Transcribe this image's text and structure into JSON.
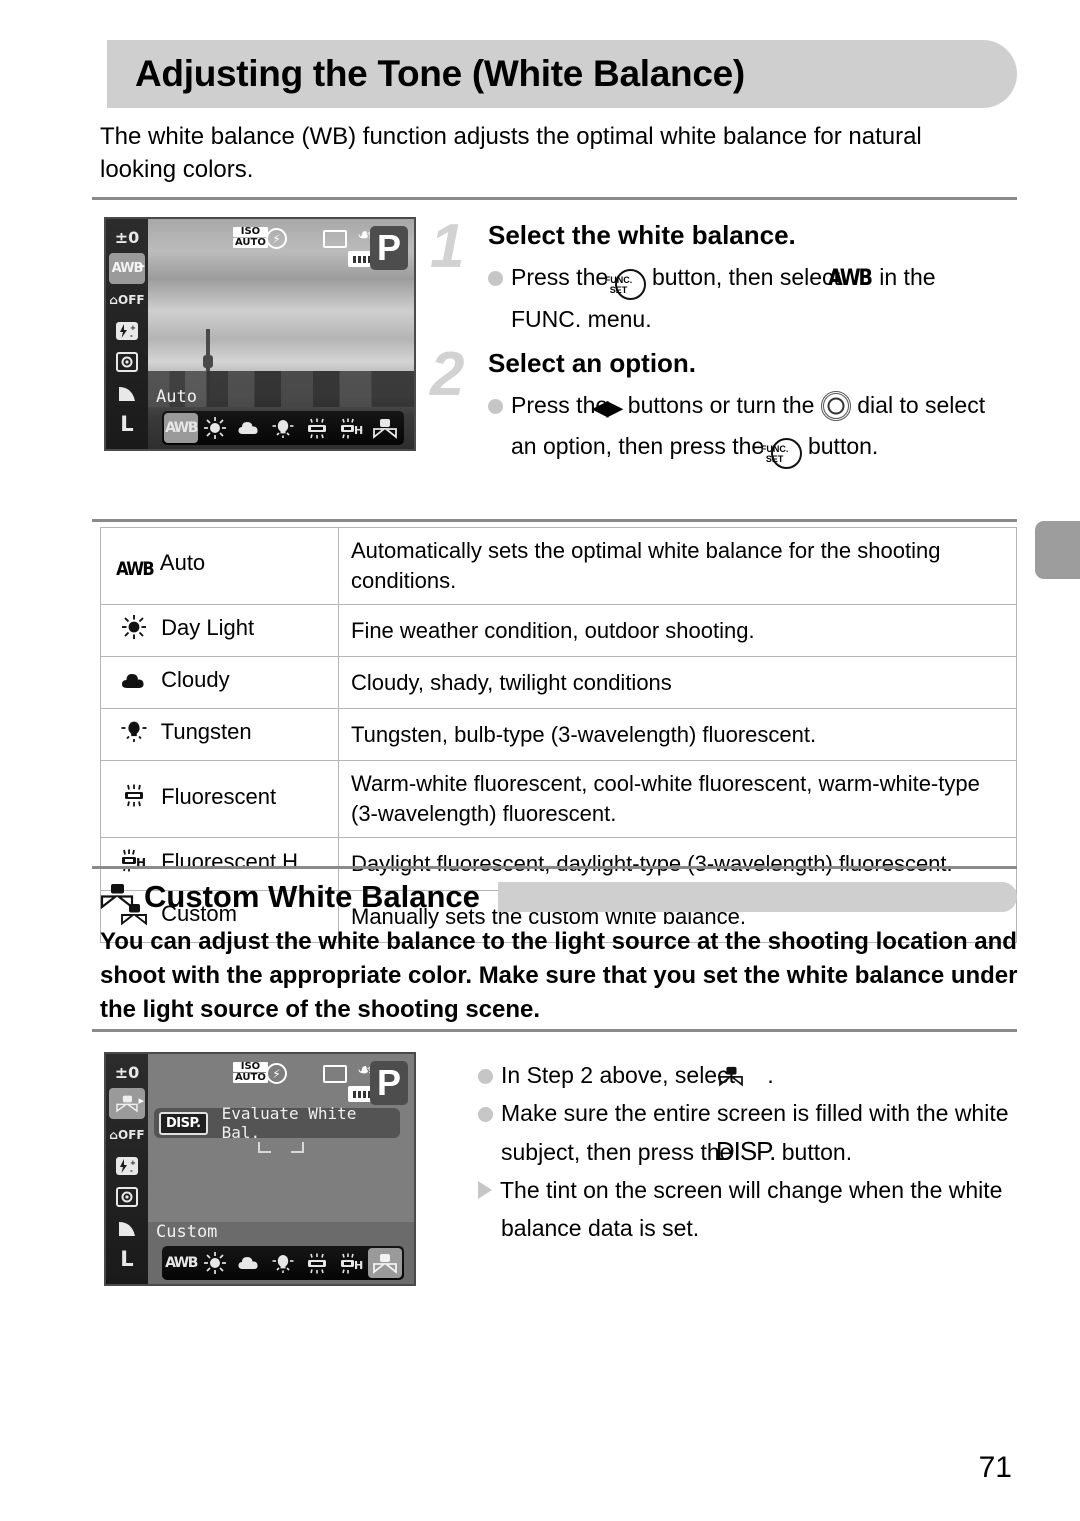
{
  "title": "Adjusting the Tone (White Balance)",
  "intro": "The white balance (WB) function adjusts the optimal white balance for natural looking colors.",
  "steps": [
    {
      "number": "1",
      "heading": "Select the white balance.",
      "body_before": "Press the",
      "body_mid": "button, then select",
      "body_after": "in the FUNC. menu.",
      "icon_funcset": "FUNC.SET",
      "icon_awb": "AWB"
    },
    {
      "number": "2",
      "heading": "Select an option.",
      "body_before": "Press the",
      "body_mid": "buttons or turn the",
      "body_mid2": "dial to select an option, then press the",
      "body_after": "button.",
      "icon_lr": "left-right-buttons",
      "icon_dial": "control-dial",
      "icon_funcset": "FUNC.SET"
    }
  ],
  "table": {
    "rows": [
      {
        "icon": "awb-icon",
        "name": "Auto",
        "desc": "Automatically sets the optimal white balance for the shooting conditions."
      },
      {
        "icon": "daylight-icon",
        "name": "Day Light",
        "desc": "Fine weather condition, outdoor shooting."
      },
      {
        "icon": "cloudy-icon",
        "name": "Cloudy",
        "desc": "Cloudy, shady, twilight conditions"
      },
      {
        "icon": "tungsten-icon",
        "name": "Tungsten",
        "desc": "Tungsten, bulb-type (3-wavelength) fluorescent."
      },
      {
        "icon": "fluorescent-icon",
        "name": "Fluorescent",
        "desc": "Warm-white fluorescent, cool-white fluorescent, warm-white-type (3-wavelength) fluorescent."
      },
      {
        "icon": "fluorescent-h-icon",
        "name": "Fluorescent H",
        "desc": "Daylight fluorescent, daylight-type (3-wavelength) fluorescent."
      },
      {
        "icon": "custom-wb-icon",
        "name": "Custom",
        "desc": "Manually sets the custom white balance."
      }
    ]
  },
  "custom_section": {
    "heading": "Custom White Balance",
    "paragraph": "You can adjust the white balance to the light source at the shooting location and shoot with the appropriate color. Make sure that you set the white balance under the light source of the shooting scene.",
    "items": [
      {
        "bullet": "dot",
        "text_before": "In Step 2 above, select",
        "text_after": "."
      },
      {
        "bullet": "dot",
        "text_before": "Make sure the entire screen is filled with the white subject, then press the",
        "text_after": "button.",
        "icon": "DISP."
      },
      {
        "bullet": "triangle",
        "text_before": "The tint on the screen will change when the white balance data is set.",
        "text_after": ""
      }
    ]
  },
  "lcd_screen_1": {
    "sidebar": [
      "±0",
      "AWB",
      "OFF",
      "FEC",
      "MET",
      "QUAL",
      "L"
    ],
    "sidebar_selected": "AWB",
    "status": {
      "iso_line1": "ISO",
      "iso_line2": "AUTO",
      "mode": "P"
    },
    "mode_label": "Auto",
    "options": [
      "AWB",
      "Day Light",
      "Cloudy",
      "Tungsten",
      "Fluorescent",
      "Fluorescent H",
      "Custom"
    ],
    "selected_option": "AWB"
  },
  "lcd_screen_2": {
    "sidebar": [
      "±0",
      "CWB",
      "OFF",
      "FEC",
      "MET",
      "QUAL",
      "L"
    ],
    "sidebar_selected": "CWB",
    "status": {
      "iso_line1": "ISO",
      "iso_line2": "AUTO",
      "mode": "P"
    },
    "disp_chip": "DISP.",
    "disp_text": "Evaluate White Bal.",
    "mode_label": "Custom",
    "options": [
      "AWB",
      "Day Light",
      "Cloudy",
      "Tungsten",
      "Fluorescent",
      "Fluorescent H",
      "Custom"
    ],
    "selected_option": "Custom"
  },
  "page_number": "71",
  "colors": {
    "banner": "#cfcfcf",
    "rule": "#8a8a8a",
    "step_number": "#d2d2d2",
    "bullet": "#c6c6c6",
    "tab": "#9d9d9d"
  }
}
